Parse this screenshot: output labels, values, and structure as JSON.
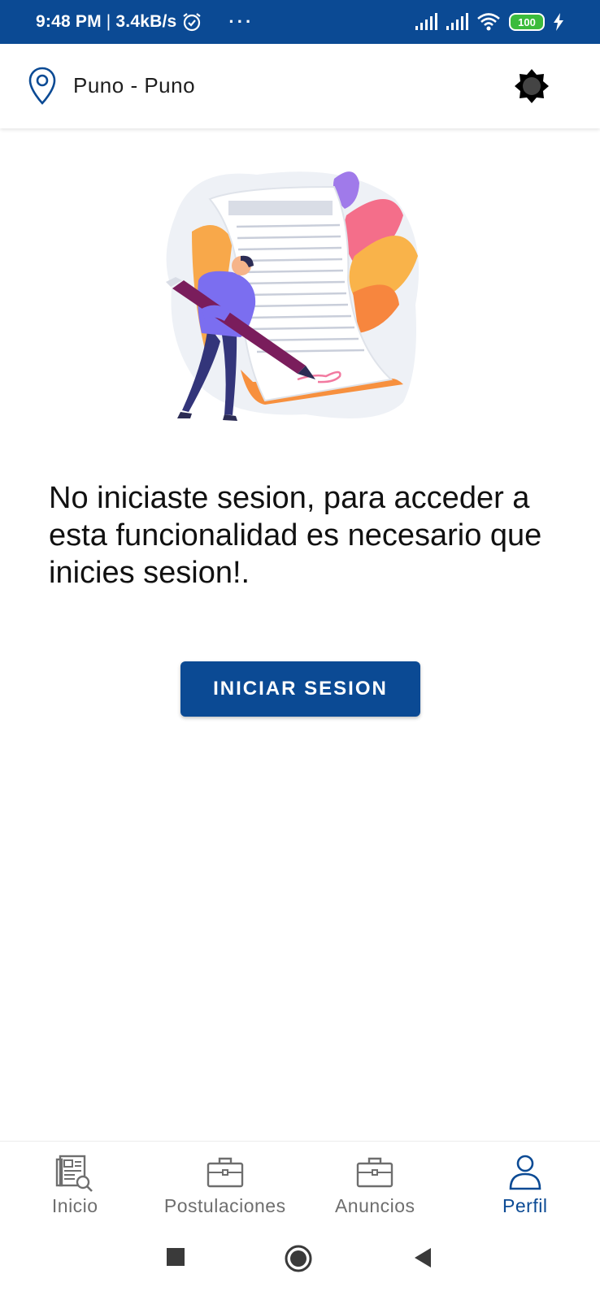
{
  "status_bar": {
    "time": "9:48 PM",
    "separator": "|",
    "speed": "3.4kB/s",
    "more": "···",
    "battery": "100"
  },
  "header": {
    "location": "Puno - Puno",
    "location_icon": "location-pin-icon",
    "theme_icon": "brightness-icon"
  },
  "main": {
    "message": "No iniciaste sesion, para acceder a esta funcionalidad es necesario que inicies sesion!.",
    "button_label": "INICIAR SESION"
  },
  "bottom_nav": {
    "items": [
      {
        "label": "Inicio",
        "icon": "newspaper-search-icon",
        "active": false
      },
      {
        "label": "Postulaciones",
        "icon": "briefcase-icon",
        "active": false
      },
      {
        "label": "Anuncios",
        "icon": "briefcase-icon",
        "active": false
      },
      {
        "label": "Perfil",
        "icon": "user-icon",
        "active": true
      }
    ]
  },
  "colors": {
    "brand_blue": "#0b4a94",
    "inactive_gray": "#6e6e6e",
    "battery_green": "#3cbb3c"
  }
}
